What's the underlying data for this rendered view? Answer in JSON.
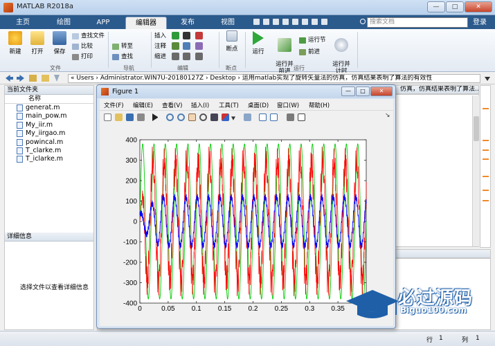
{
  "window": {
    "title": "MATLAB R2018a",
    "controls": [
      "—",
      "□",
      "✕"
    ]
  },
  "tabs": [
    {
      "label": "主页"
    },
    {
      "label": "绘图"
    },
    {
      "label": "APP"
    },
    {
      "label": "编辑器"
    },
    {
      "label": "发布"
    },
    {
      "label": "视图"
    }
  ],
  "search": {
    "placeholder": "搜索文档"
  },
  "login": "登录",
  "ribbon": {
    "file_group": {
      "label": "文件",
      "new": "新建",
      "open": "打开",
      "save": "保存",
      "find_files": "查找文件",
      "compare": "比较",
      "print": "打印"
    },
    "nav_group": {
      "label": "导航",
      "goto": "转至",
      "find": "查找"
    },
    "edit_group": {
      "label": "编辑",
      "insert": "插入",
      "comment": "注释",
      "indent": "缩进"
    },
    "breakpoint_group": {
      "label": "断点",
      "breakpoints": "断点"
    },
    "run_group": {
      "label": "运行",
      "run": "运行",
      "run_advance": "运行并\n前进",
      "run_section": "运行节",
      "advance": "前进",
      "run_time": "运行并\n计时"
    }
  },
  "address": {
    "path": "« Users › Administrator.WIN7U-20180127Z › Desktop › 运用matlab实现了旋转矢量法的仿真，仿真结果表明了算法的有效性"
  },
  "current_folder": {
    "header": "当前文件夹",
    "column": "名称",
    "files": [
      "generat.m",
      "main_pow.m",
      "My_iir.m",
      "My_iirgao.m",
      "powincal.m",
      "T_clarke.m",
      "T_iclarke.m"
    ]
  },
  "details": {
    "header": "详细信息",
    "message": "选择文件以查看详细信息"
  },
  "editor_header": "仿真，仿真结果表明了算法...",
  "status": {
    "row_label": "行",
    "row_value": "1",
    "col_label": "列",
    "col_value": "1"
  },
  "figure": {
    "title": "Figure 1",
    "menu": [
      "文件(F)",
      "编辑(E)",
      "查看(V)",
      "插入(I)",
      "工具(T)",
      "桌面(D)",
      "窗口(W)",
      "帮助(H)"
    ]
  },
  "chart_data": {
    "type": "line",
    "xlim": [
      0,
      0.4
    ],
    "ylim": [
      -400,
      400
    ],
    "xticks": [
      0,
      0.05,
      0.1,
      0.15,
      0.2,
      0.25,
      0.3,
      0.35
    ],
    "yticks": [
      400,
      300,
      200,
      100,
      0,
      -100,
      -200,
      -300,
      -400
    ],
    "xtick_labels": [
      "0",
      "0.05",
      "0.1",
      "0.15",
      "0.2",
      "0.25",
      "0.3",
      "0.35"
    ],
    "ytick_labels": [
      "400",
      "300",
      "200",
      "100",
      "0",
      "-100",
      "-200",
      "-300",
      "-400"
    ],
    "series": [
      {
        "color": "#00cc00",
        "amplitude": 380,
        "frequency_hz": 50,
        "description": "green sinusoid"
      },
      {
        "color": "#ff0000",
        "amplitude": 290,
        "frequency_hz": 50,
        "description": "red noisy sinusoid"
      },
      {
        "color": "#0000ff",
        "amplitude": 120,
        "frequency_hz": 50,
        "description": "blue sinusoid, ramping"
      }
    ],
    "grid": false
  },
  "watermark": {
    "main": "必过源码",
    "sub": "Biguo100.com"
  }
}
